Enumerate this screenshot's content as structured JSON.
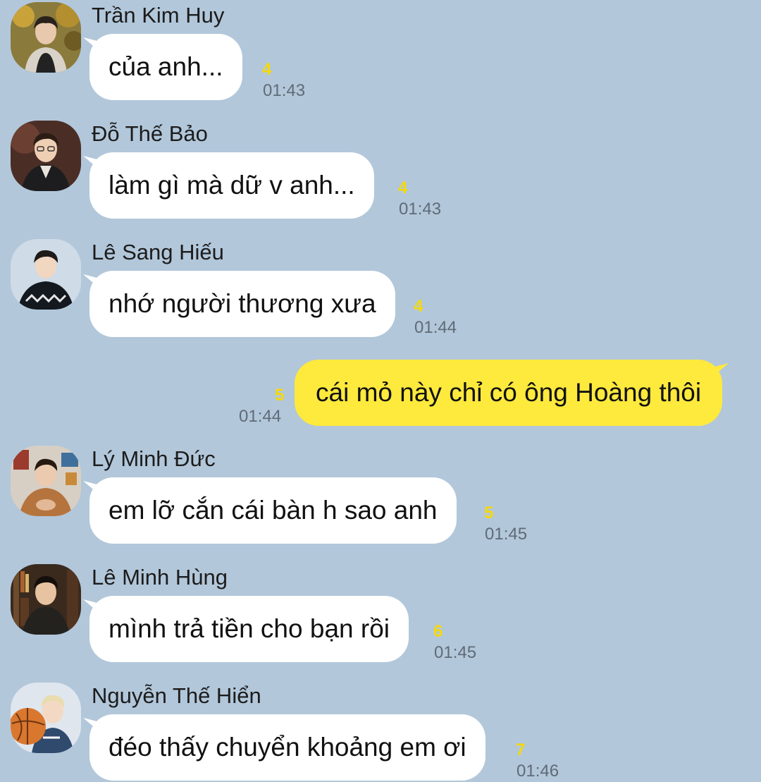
{
  "messages": [
    {
      "sender": "Trần Kim Huy",
      "text": "của anh...",
      "unread": "4",
      "time": "01:43",
      "avatar": "avatar-tran-kim-huy"
    },
    {
      "sender": "Đỗ Thế Bảo",
      "text": "làm gì mà dữ v anh...",
      "unread": "4",
      "time": "01:43",
      "avatar": "avatar-do-the-bao"
    },
    {
      "sender": "Lê Sang Hiếu",
      "text": "nhớ người thương xưa",
      "unread": "4",
      "time": "01:44",
      "avatar": "avatar-le-sang-hieu"
    },
    {
      "sender": "",
      "text": "cái mỏ này chỉ có ông Hoàng thôi",
      "unread": "5",
      "time": "01:44",
      "outgoing": true
    },
    {
      "sender": "Lý Minh Đức",
      "text": "em lỡ cắn cái bàn h sao anh",
      "unread": "5",
      "time": "01:45",
      "avatar": "avatar-ly-minh-duc"
    },
    {
      "sender": "Lê Minh Hùng",
      "text": "mình trả tiền cho bạn rồi",
      "unread": "6",
      "time": "01:45",
      "avatar": "avatar-le-minh-hung"
    },
    {
      "sender": "Nguyễn Thế Hiển",
      "text": "đéo thấy chuyển khoảng em ơi",
      "unread": "7",
      "time": "01:46",
      "avatar": "avatar-nguyen-the-hien"
    }
  ],
  "colors": {
    "background": "#b2c7da",
    "incoming_bubble": "#ffffff",
    "outgoing_bubble": "#fee93d",
    "unread_count": "#f5d90a",
    "timestamp": "#5f6b78"
  }
}
